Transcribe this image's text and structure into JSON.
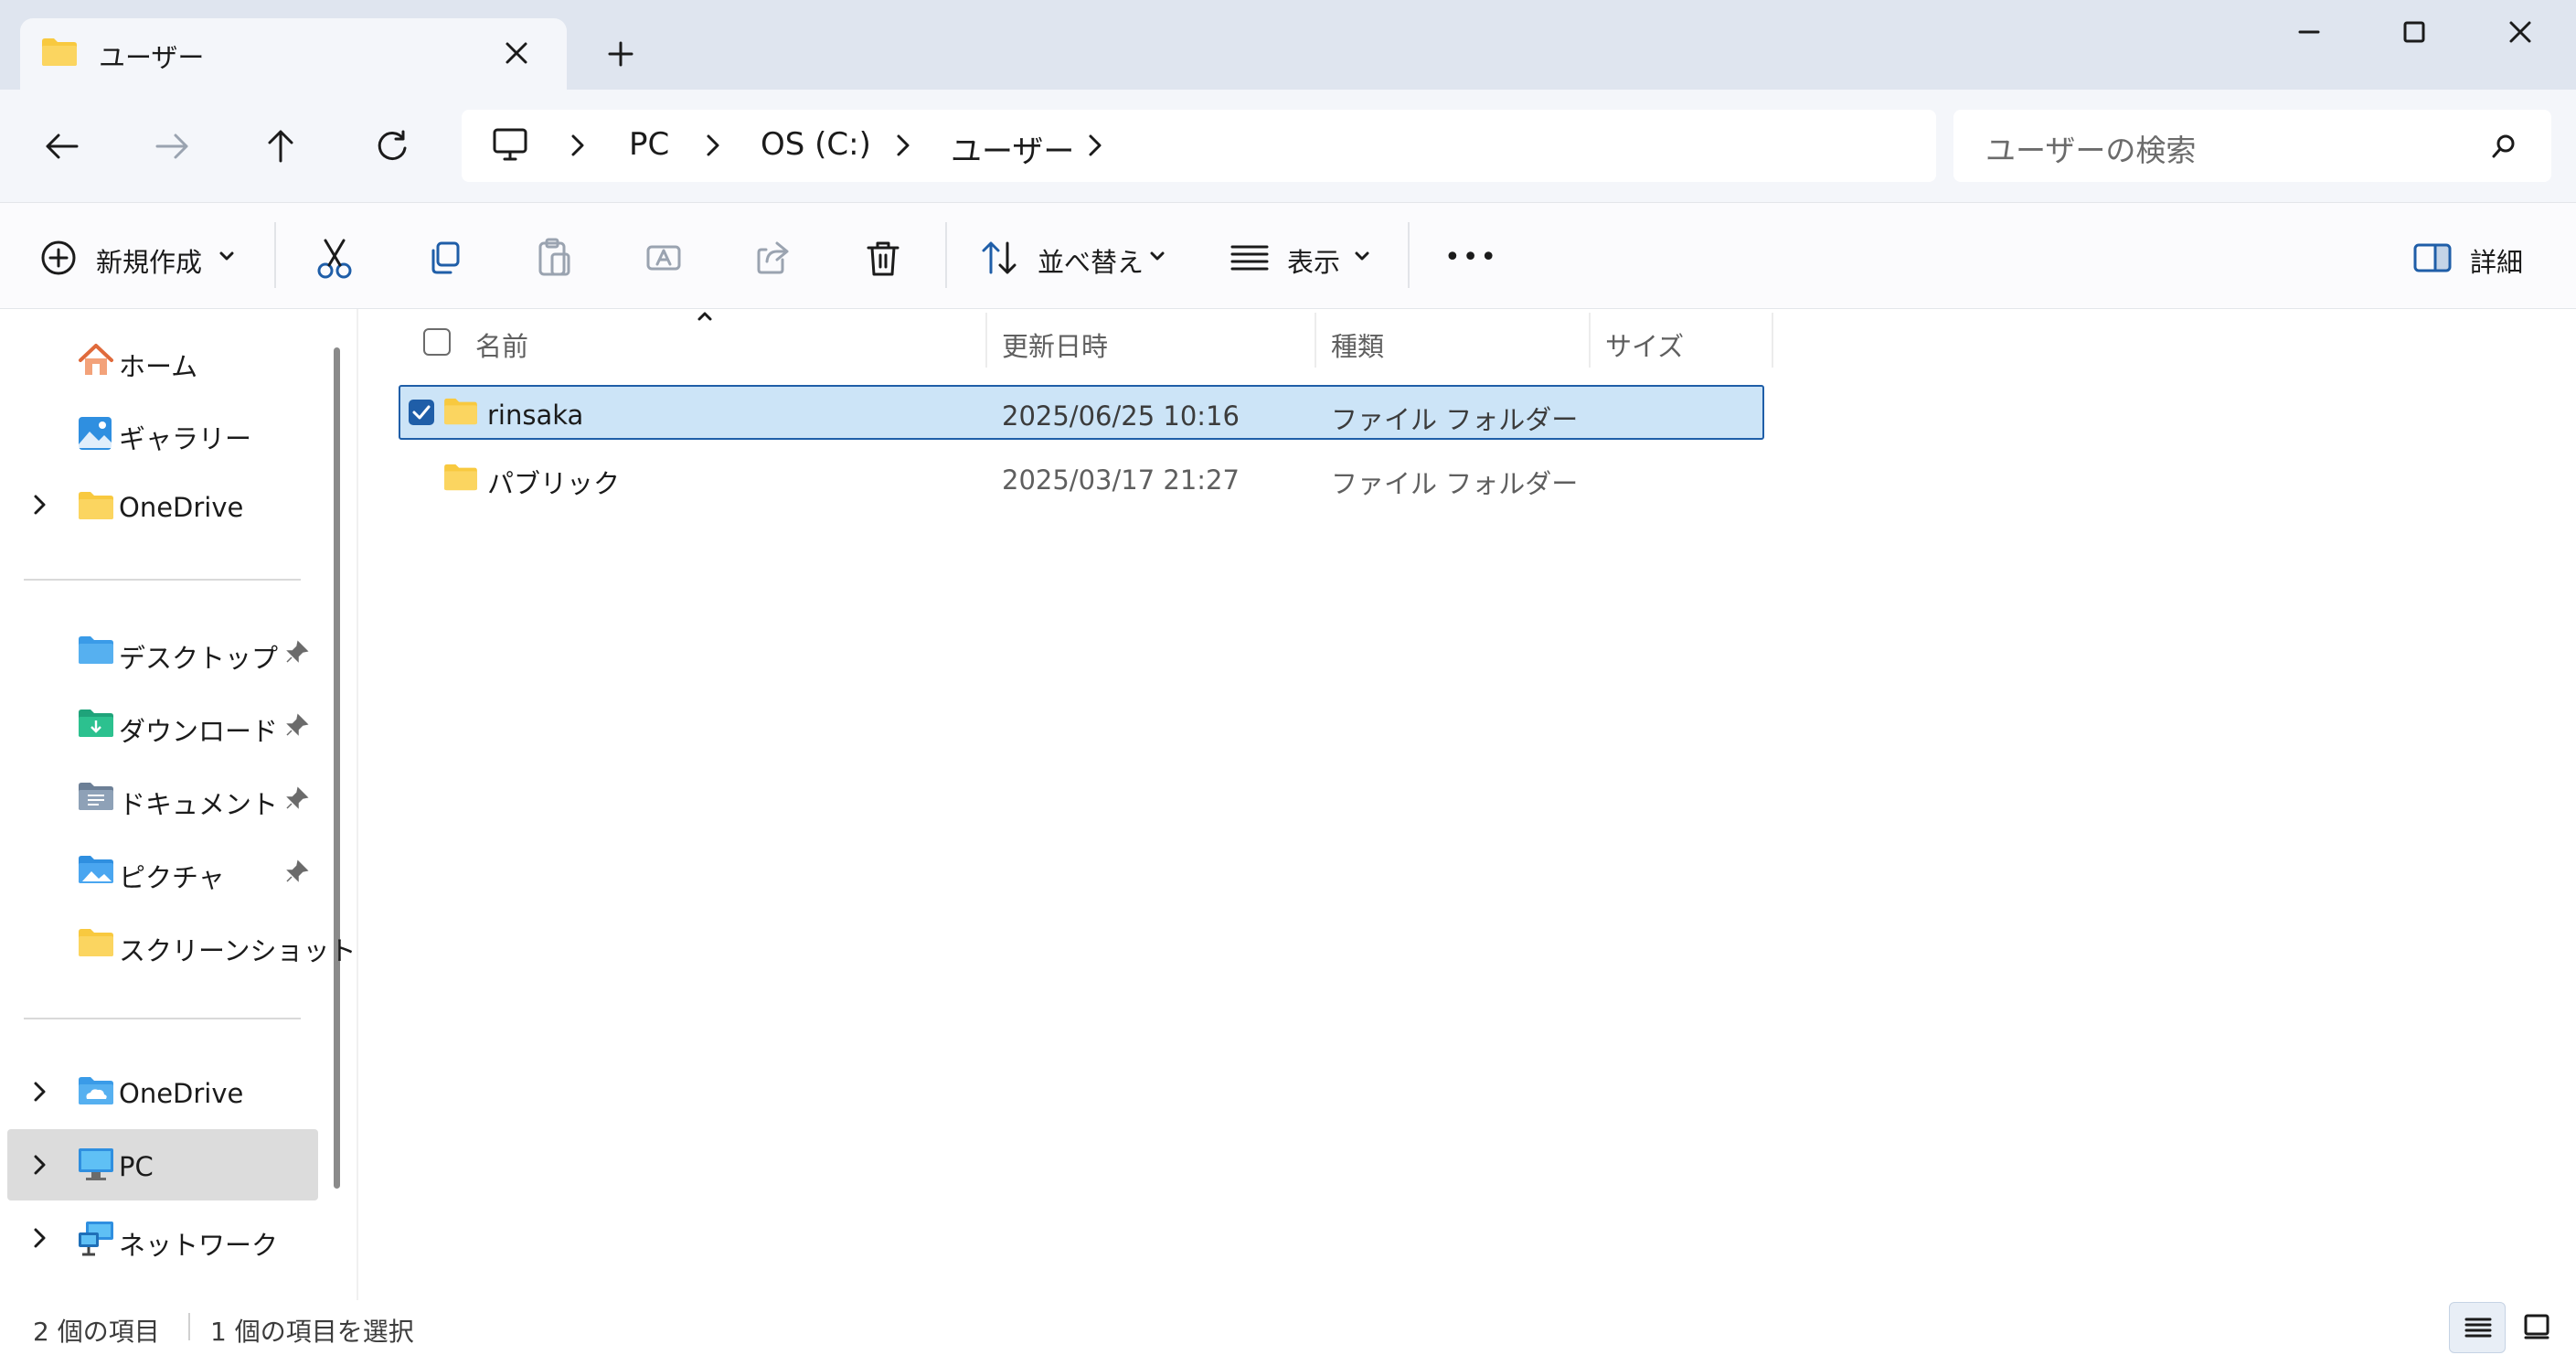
{
  "window": {
    "tab_title": "ユーザー",
    "new_tab": "+",
    "controls": [
      "minimize",
      "maximize",
      "close"
    ]
  },
  "address": {
    "crumbs": [
      "PC",
      "OS (C:)",
      "ユーザー"
    ],
    "search_placeholder": "ユーザーの検索"
  },
  "toolbar": {
    "new_label": "新規作成",
    "sort_label": "並べ替え",
    "view_label": "表示",
    "more_label": "•••",
    "details_label": "詳細"
  },
  "nav": {
    "home": "ホーム",
    "gallery": "ギャラリー",
    "onedrive_personal": "OneDrive",
    "desktop": "デスクトップ",
    "downloads": "ダウンロード",
    "documents": "ドキュメント",
    "pictures": "ピクチャ",
    "screenshots": "スクリーンショット",
    "onedrive": "OneDrive",
    "pc": "PC",
    "network": "ネットワーク"
  },
  "columns": {
    "name": "名前",
    "modified": "更新日時",
    "type": "種類",
    "size": "サイズ"
  },
  "files": [
    {
      "name": "rinsaka",
      "modified": "2025/06/25 10:16",
      "type": "ファイル フォルダー",
      "selected": true
    },
    {
      "name": "パブリック",
      "modified": "2025/03/17 21:27",
      "type": "ファイル フォルダー",
      "selected": false
    }
  ],
  "status": {
    "item_count": "2 個の項目",
    "selected_count": "1 個の項目を選択"
  },
  "colors": {
    "accent": "#1f5ea8",
    "selection": "#cce4f7",
    "folder": "#f8c93f"
  }
}
